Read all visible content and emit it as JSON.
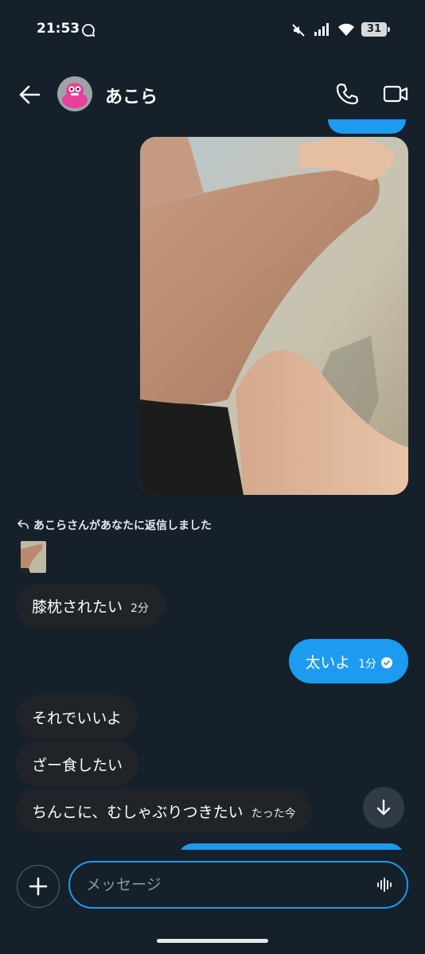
{
  "status_bar": {
    "time": "21:53",
    "battery": "31"
  },
  "header": {
    "contact_name": "あこら"
  },
  "reply_notice": "あこらさんがあなたに返信しました",
  "messages": [
    {
      "direction": "incoming",
      "text": "膝枕されたい",
      "time": "2分"
    },
    {
      "direction": "outgoing",
      "text": "太いよ",
      "time": "1分"
    },
    {
      "direction": "incoming",
      "text": "それでいいよ",
      "time": ""
    },
    {
      "direction": "incoming",
      "text": "ざー食したい",
      "time": ""
    },
    {
      "direction": "incoming",
      "text": "ちんこに、むしゃぶりつきたい",
      "time": "たった今"
    }
  ],
  "composer": {
    "placeholder": "メッセージ"
  },
  "colors": {
    "background": "#15202b",
    "accent": "#1d9bf0",
    "incoming_bubble": "#202327"
  },
  "icons": {
    "status": [
      "chat-bubble-icon",
      "mute-icon",
      "signal-icon",
      "wifi-icon",
      "battery-icon"
    ],
    "header": [
      "back-arrow-icon",
      "phone-icon",
      "video-camera-icon"
    ],
    "composer": [
      "plus-icon",
      "voice-waveform-icon"
    ],
    "other": [
      "reply-arrow-icon",
      "sent-check-icon",
      "arrow-down-icon"
    ]
  }
}
